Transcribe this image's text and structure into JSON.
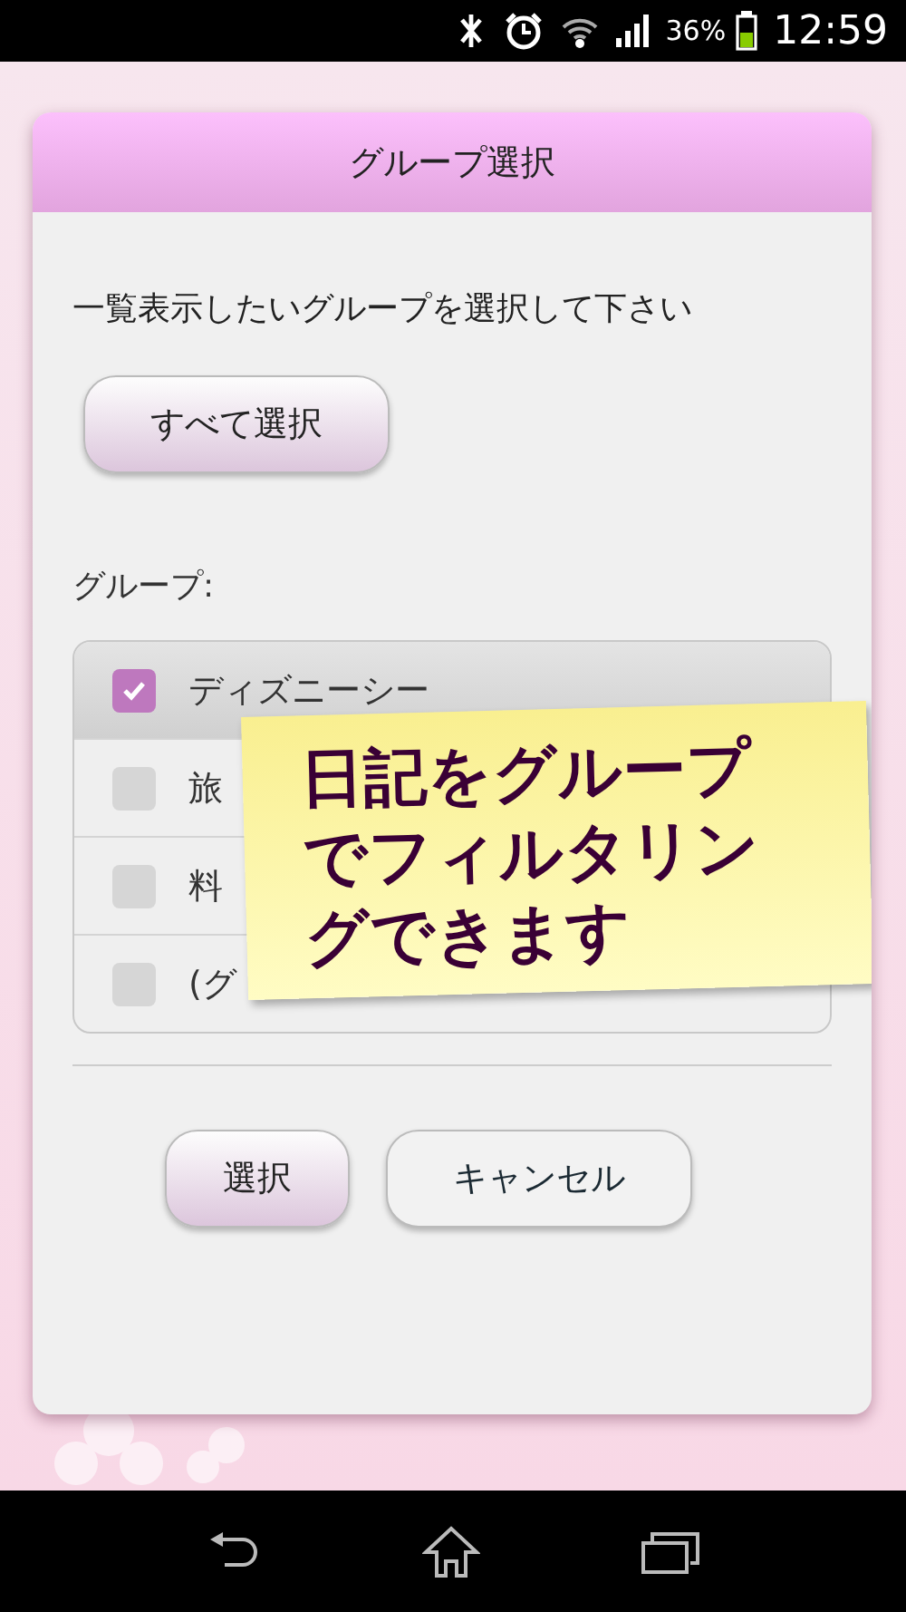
{
  "status_bar": {
    "battery_percent": "36%",
    "time": "12:59"
  },
  "dialog": {
    "title": "グループ選択",
    "message": "一覧表示したいグループを選択して下さい",
    "select_all_button": "すべて選択",
    "group_label": "グループ:",
    "groups": [
      {
        "label": "ディズニーシー",
        "checked": true
      },
      {
        "label": "旅",
        "checked": false
      },
      {
        "label": "料",
        "checked": false
      },
      {
        "label": "(グ",
        "checked": false
      }
    ],
    "buttons": [
      {
        "label": "選択",
        "kind": "primary"
      },
      {
        "label": "キャンセル",
        "kind": "secondary"
      }
    ]
  },
  "sticky_note": {
    "lines": [
      "日記をグループ",
      "でフィルタリン",
      "グできます"
    ]
  }
}
